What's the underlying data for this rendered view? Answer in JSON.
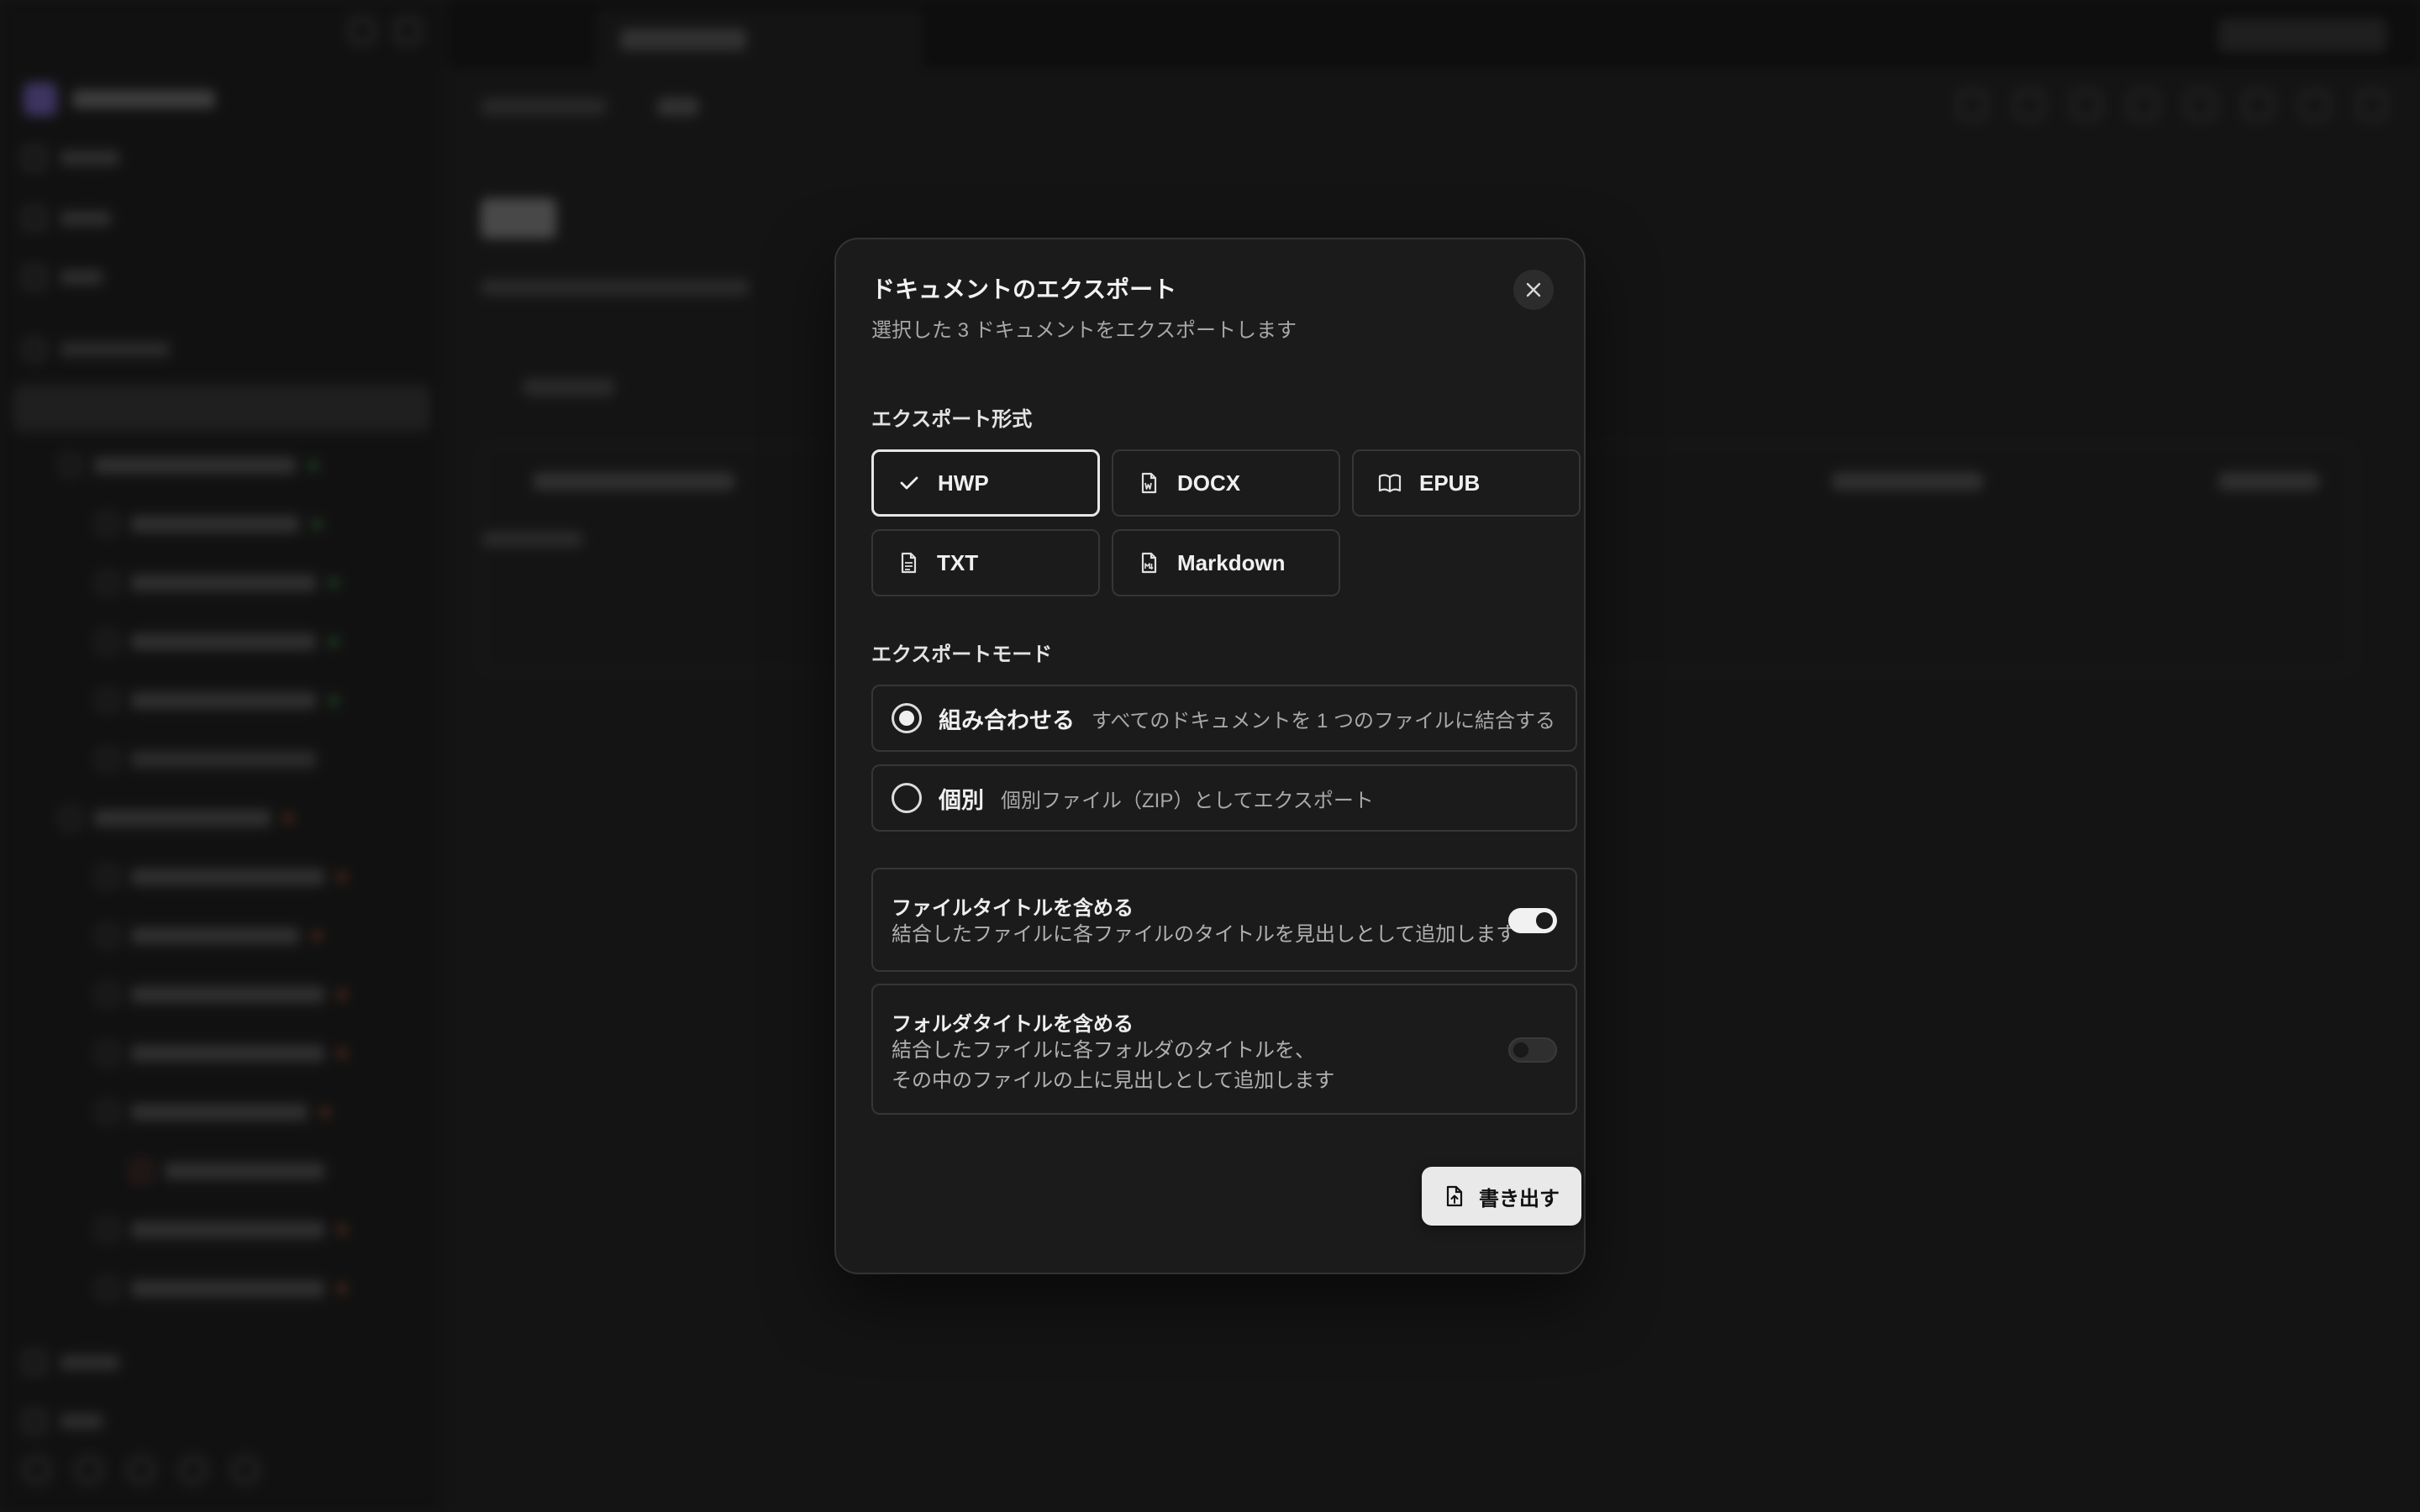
{
  "dialog": {
    "title": "ドキュメントのエクスポート",
    "subtitle": "選択した 3 ドキュメントをエクスポートします",
    "format_section_label": "エクスポート形式",
    "formats": [
      {
        "label": "HWP",
        "icon": "check-icon",
        "selected": true
      },
      {
        "label": "DOCX",
        "icon": "word-file-icon",
        "selected": false
      },
      {
        "label": "EPUB",
        "icon": "book-open-icon",
        "selected": false
      },
      {
        "label": "TXT",
        "icon": "text-file-icon",
        "selected": false
      },
      {
        "label": "Markdown",
        "icon": "markdown-file-icon",
        "selected": false
      }
    ],
    "mode_section_label": "エクスポートモード",
    "modes": [
      {
        "label": "組み合わせる",
        "description": "すべてのドキュメントを 1 つのファイルに結合する",
        "selected": true
      },
      {
        "label": "個別",
        "description": "個別ファイル（ZIP）としてエクスポート",
        "selected": false
      }
    ],
    "options": [
      {
        "title": "ファイルタイトルを含める",
        "description_lines": [
          "結合したファイルに各ファイルのタイトルを見出しとして追加します"
        ],
        "enabled": true
      },
      {
        "title": "フォルダタイトルを含める",
        "description_lines": [
          "結合したファイルに各フォルダのタイトルを、",
          "その中のファイルの上に見出しとして追加します"
        ],
        "enabled": false
      }
    ],
    "export_button_label": "書き出す"
  },
  "colors": {
    "dialog_bg": "#1b1b1b",
    "border": "#363636",
    "accent": "#e9e9e9",
    "subtle_text": "#a8a8a8"
  }
}
